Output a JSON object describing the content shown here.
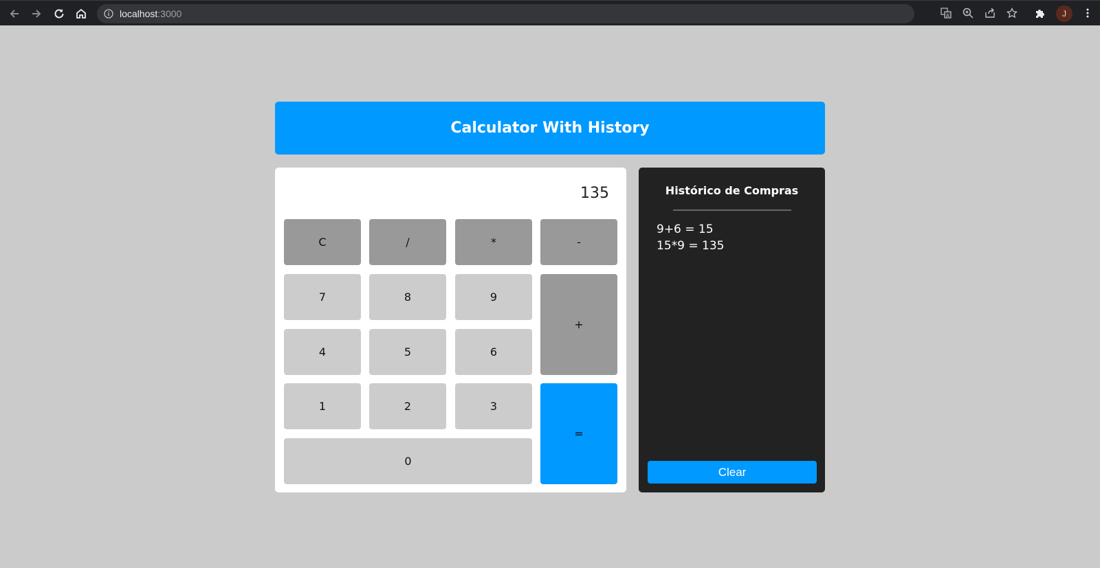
{
  "browser": {
    "url_host": "localhost",
    "url_port": ":3000",
    "profile_initial": "J",
    "icons": [
      "back-icon",
      "forward-icon",
      "reload-icon",
      "home-icon",
      "info-icon",
      "translate-icon",
      "zoom-icon",
      "share-icon",
      "bookmark-star-icon",
      "extensions-icon",
      "menu-icon"
    ]
  },
  "app": {
    "title": "Calculator With History"
  },
  "calculator": {
    "display": "135",
    "keys": {
      "clear": "C",
      "divide": "/",
      "multiply": "*",
      "subtract": "-",
      "add": "+",
      "equals": "=",
      "seven": "7",
      "eight": "8",
      "nine": "9",
      "four": "4",
      "five": "5",
      "six": "6",
      "one": "1",
      "two": "2",
      "three": "3",
      "zero": "0"
    }
  },
  "history": {
    "title": "Histórico de Compras",
    "entries": [
      "9+6 = 15",
      "15*9 = 135"
    ],
    "clear_label": "Clear"
  },
  "colors": {
    "accent": "#0099ff",
    "background": "#cbcbcb",
    "operator_key": "#999999",
    "number_key": "#cccccc",
    "history_panel": "#222222"
  }
}
